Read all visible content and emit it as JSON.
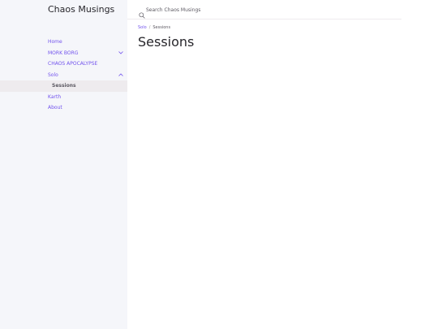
{
  "site": {
    "title": "Chaos Musings"
  },
  "sidebar": {
    "items": [
      {
        "label": "Home"
      },
      {
        "label": "MORK BORG"
      },
      {
        "label": "CHAOS APOCALYPSE"
      },
      {
        "label": "Solo"
      },
      {
        "label": "Sessions"
      },
      {
        "label": "Karth"
      },
      {
        "label": "About"
      }
    ]
  },
  "search": {
    "placeholder": "Search Chaos Musings"
  },
  "breadcrumb": {
    "parent": "Solo",
    "separator": "/",
    "current": "Sessions"
  },
  "page": {
    "title": "Sessions"
  },
  "colors": {
    "accent": "#7253ed",
    "sidebar_bg": "#f5f6fa",
    "active_bg": "#eeebee"
  },
  "icons": {
    "search": "search-icon",
    "expand": "chevron-down-icon",
    "collapse": "chevron-up-icon"
  }
}
